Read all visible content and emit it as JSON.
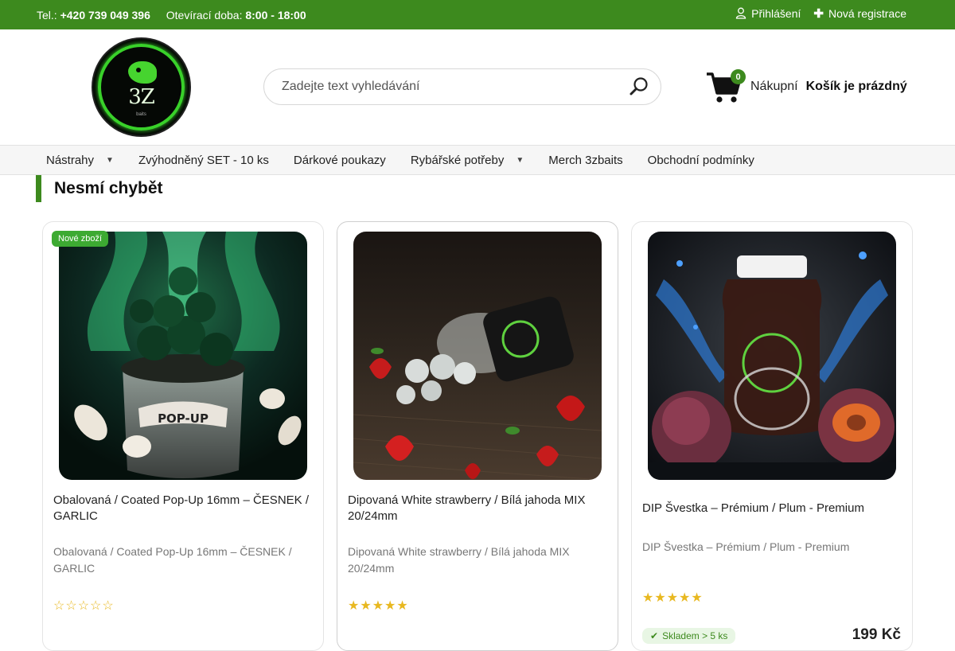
{
  "topbar": {
    "phone_label": "Tel.:",
    "phone": "+420 739 049 396",
    "hours_label": "Otevírací doba:",
    "hours": "8:00 - 18:00",
    "login": "Přihlášení",
    "register": "Nová registrace"
  },
  "logo": {
    "text": "3Z",
    "small": "baits"
  },
  "search": {
    "placeholder": "Zadejte text vyhledávání"
  },
  "cart": {
    "count": "0",
    "label": "Nákupní",
    "status": "Košík je prázdný"
  },
  "nav": [
    {
      "label": "Nástrahy"
    },
    {
      "label": "Zvýhodněný SET - 10 ks"
    },
    {
      "label": "Dárkové poukazy"
    },
    {
      "label": "Rybářské potřeby"
    },
    {
      "label": "Merch 3zbaits"
    },
    {
      "label": "Obchodní podmínky"
    }
  ],
  "section": {
    "title": "Nesmí chybět"
  },
  "products": [
    {
      "tag": "Nové zboží",
      "name": "Obalovaná / Coated Pop-Up 16mm – ČESNEK / GARLIC",
      "desc": "Obalovaná / Coated Pop-Up 16mm – ČESNEK / GARLIC",
      "rating": 0,
      "label_overlay": "POP-UP"
    },
    {
      "name": "Dipovaná White strawberry / Bílá jahoda MIX 20/24mm",
      "desc": "Dipovaná White strawberry / Bílá jahoda MIX 20/24mm",
      "rating": 5
    },
    {
      "name": "DIP Švestka – Prémium / Plum - Premium",
      "desc": "DIP Švestka – Prémium / Plum - Premium",
      "rating": 5,
      "stock": "Skladem > 5 ks",
      "price": "199 Kč"
    }
  ],
  "colors": {
    "brand": "#3d8a1e",
    "star": "#e8b820"
  }
}
